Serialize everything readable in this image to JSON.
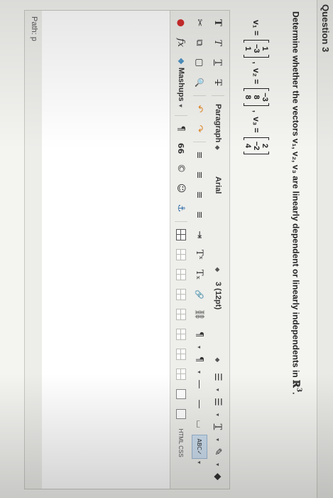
{
  "question": {
    "title": "Question 3",
    "prompt": "Determine whether the vectors  v₁, v₂, v₃ are linearly dependent or linearly independents in ",
    "space": "ℝ",
    "space_exp": "3",
    "period": "."
  },
  "vectors": [
    {
      "name": "v₁ =",
      "entries": [
        "1",
        "−3",
        "1"
      ],
      "sep": ","
    },
    {
      "name": "v₂ =",
      "entries": [
        "−3",
        "8",
        "8"
      ],
      "sep": ","
    },
    {
      "name": "v₃ =",
      "entries": [
        "2",
        "−2",
        "4"
      ],
      "sep": ""
    }
  ],
  "toolbar": {
    "row1": {
      "bold": "T",
      "italic": "T",
      "underline": "T",
      "strike": "T",
      "paragraph": "Paragraph",
      "paragraph_caret": "◆",
      "font": "Arial",
      "font_caret": "◆",
      "size": "3 (12pt)",
      "size_caret": "◆",
      "ul": "☰",
      "ol": "☰",
      "text_color": "T",
      "bg_color": "✎",
      "clear": "◆"
    },
    "row2": {
      "cut": "✂",
      "copy": "⧉",
      "paste": "▢",
      "find": "🔍",
      "undo": "↶",
      "redo": "↷",
      "align_left": "≡",
      "align_center": "≡",
      "align_right": "≡",
      "align_justify": "≡",
      "indent": "⇥",
      "superscript": "Tˣ",
      "subscript": "Tₓ",
      "link": "🔗",
      "unlink": "⛓",
      "ltr": "¶",
      "rtl": "¶",
      "hr": "—",
      "hr2": "—",
      "special": "⌴",
      "spellcheck": "ABC✓"
    },
    "row3": {
      "record": "●",
      "fx": "fx",
      "mashups": "Mashups",
      "pilcrow": "¶",
      "quote": "66",
      "copyright": "©",
      "emoji": "☺",
      "anchor": "⚓",
      "html_css": "HTML CSS"
    }
  },
  "status": {
    "path_label": "Path:",
    "path_value": "p"
  },
  "colors": {
    "page_bg": "#f4f4f1",
    "toolbar_bg": "#eeeeeb",
    "accent_red": "#d12d2d"
  }
}
